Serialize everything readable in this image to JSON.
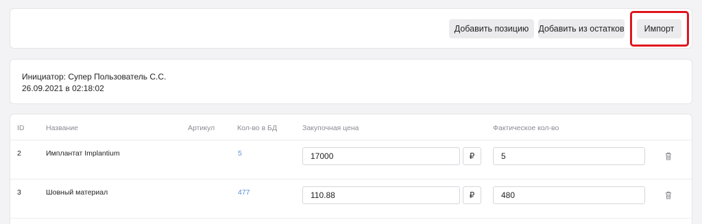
{
  "toolbar": {
    "add_position_label": "Добавить позицию",
    "add_from_stock_label": "Добавить из остатков",
    "import_label": "Импорт"
  },
  "info": {
    "initiator": "Инициатор: Супер Пользователь С.С.",
    "datetime": "26.09.2021 в 02:18:02"
  },
  "table": {
    "headers": {
      "id": "ID",
      "name": "Название",
      "article": "Артикул",
      "db_qty": "Кол-во в БД",
      "purchase_price": "Закупочная цена",
      "actual_qty": "Фактическое кол-во"
    },
    "rows": [
      {
        "id": "2",
        "name": "Имплантат Implantium",
        "article": "",
        "db_qty": "5",
        "price": "17000",
        "currency": "₽",
        "actual_qty": "5"
      },
      {
        "id": "3",
        "name": "Шовный материал",
        "article": "",
        "db_qty": "477",
        "price": "110.88",
        "currency": "₽",
        "actual_qty": "480"
      }
    ]
  },
  "colors": {
    "accent_link": "#5a8ed8",
    "highlight_border": "#e0141c",
    "button_bg": "#ebebee"
  }
}
